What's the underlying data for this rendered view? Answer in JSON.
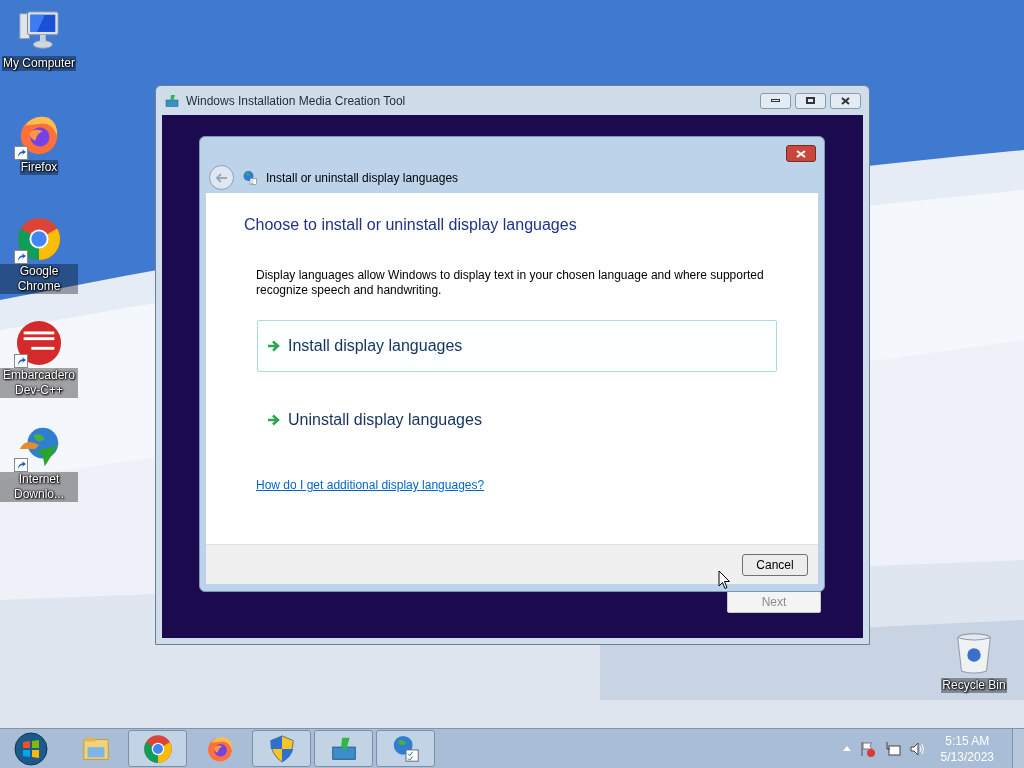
{
  "desktop_icons": [
    {
      "kind": "computer",
      "label": "My Computer",
      "shortcut": false
    },
    {
      "kind": "firefox",
      "label": "Firefox",
      "shortcut": true
    },
    {
      "kind": "chrome",
      "label": "Google Chrome",
      "shortcut": true
    },
    {
      "kind": "devcpp",
      "label": "Embarcadero Dev-C++",
      "shortcut": true
    },
    {
      "kind": "idm",
      "label": "Internet Downlo...",
      "shortcut": true
    },
    {
      "kind": "recycle",
      "label": "Recycle Bin",
      "shortcut": false
    }
  ],
  "window": {
    "title": "Windows Installation Media Creation Tool",
    "next_button": {
      "label": "Next",
      "disabled": true
    },
    "dialog": {
      "title": "Install or uninstall display languages",
      "heading": "Choose to install or uninstall display languages",
      "description": "Display languages allow Windows to display text in your chosen language and where supported recognize speech and handwriting.",
      "options": [
        {
          "label": "Install display languages",
          "selected": true
        },
        {
          "label": "Uninstall display languages",
          "selected": false
        }
      ],
      "link": "How do I get additional display languages?",
      "cancel": "Cancel"
    }
  },
  "taskbar": {
    "items": [
      {
        "kind": "explorer",
        "running": false
      },
      {
        "kind": "chrome",
        "running": true
      },
      {
        "kind": "firefox",
        "running": false
      },
      {
        "kind": "shield",
        "running": true
      },
      {
        "kind": "mediatool",
        "running": true
      },
      {
        "kind": "language",
        "running": true
      }
    ],
    "time": "5:15 AM",
    "date": "5/13/2023"
  }
}
